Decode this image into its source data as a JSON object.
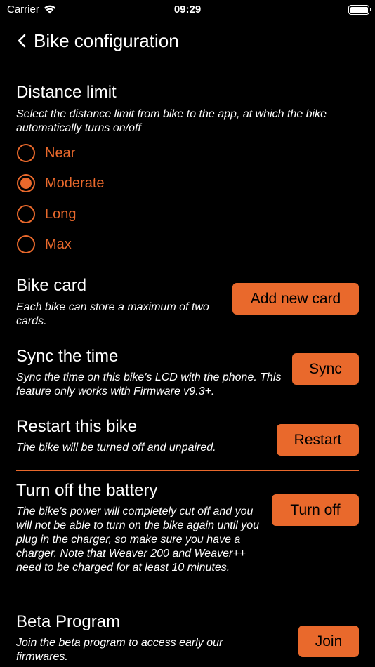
{
  "status": {
    "carrier": "Carrier",
    "time": "09:29"
  },
  "nav": {
    "title": "Bike configuration"
  },
  "distance": {
    "title": "Distance limit",
    "description": "Select the distance limit from bike to the app, at which the bike automatically turns on/off",
    "options": [
      "Near",
      "Moderate",
      "Long",
      "Max"
    ],
    "selected": "Moderate"
  },
  "bike_card": {
    "title": "Bike card",
    "description": "Each bike can store a maximum of two cards.",
    "button": "Add new card"
  },
  "sync_time": {
    "title": "Sync the time",
    "description": "Sync the time on this bike's LCD with the phone. This feature only works with Firmware v9.3+.",
    "button": "Sync"
  },
  "restart": {
    "title": "Restart this bike",
    "description": "The bike will be turned off and unpaired.",
    "button": "Restart"
  },
  "battery": {
    "title": "Turn off the battery",
    "description": "The bike's power will completely cut off and you will not be able to turn on the bike again until you plug in the charger, so make sure you have a charger. Note that Weaver 200 and Weaver++ need to be charged for at least 10 minutes.",
    "button": "Turn off"
  },
  "beta": {
    "title": "Beta Program",
    "description": "Join the beta program to access early our firmwares.",
    "button": "Join"
  },
  "colors": {
    "accent": "#e9692c",
    "background": "#000000",
    "text": "#ffffff"
  }
}
